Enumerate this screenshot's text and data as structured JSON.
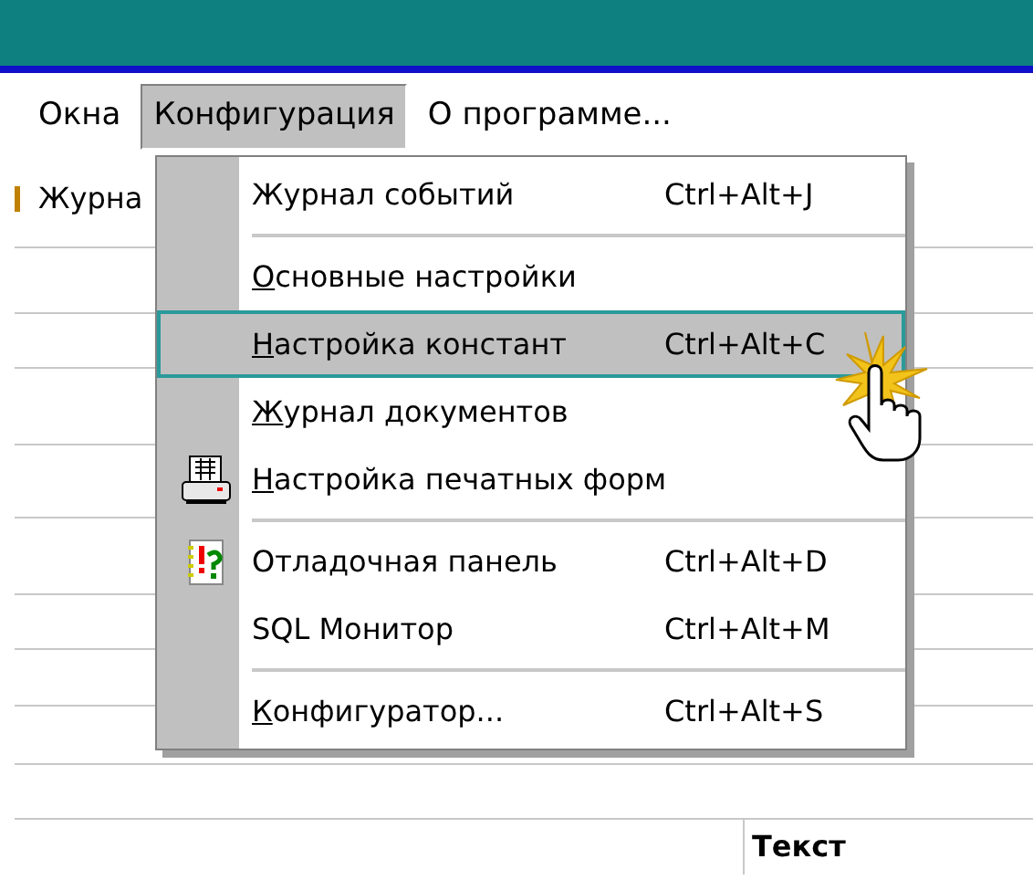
{
  "menubar": [
    {
      "label": "Окна",
      "open": false
    },
    {
      "label": "Конфигурация",
      "open": true
    },
    {
      "label": "О программе...",
      "open": false
    }
  ],
  "background": {
    "tab_label": "Журна",
    "cell": "Текст"
  },
  "menu": [
    {
      "kind": "item",
      "label": "Журнал событий",
      "shortcut": "Ctrl+Alt+J",
      "mnemonic": false,
      "selected": false
    },
    {
      "kind": "separator"
    },
    {
      "kind": "item",
      "label": "Основные настройки",
      "mnemonic": true,
      "selected": false
    },
    {
      "kind": "item",
      "label": "Настройка констант",
      "shortcut": "Ctrl+Alt+C",
      "mnemonic": true,
      "selected": true
    },
    {
      "kind": "item",
      "label": "Журнал документов",
      "mnemonic": true,
      "selected": false
    },
    {
      "kind": "printer",
      "label": "Настройка печатных форм",
      "mnemonic": true,
      "selected": false
    },
    {
      "kind": "separator"
    },
    {
      "kind": "debugger",
      "label": "Отладочная панель",
      "shortcut": "Ctrl+Alt+D",
      "mnemonic": false,
      "selected": false
    },
    {
      "kind": "item",
      "label": "SQL Монитор",
      "shortcut": "Ctrl+Alt+M",
      "mnemonic": false,
      "selected": false
    },
    {
      "kind": "separator"
    },
    {
      "kind": "item",
      "label": "Конфигуратор...",
      "shortcut": "Ctrl+Alt+S",
      "mnemonic": true,
      "selected": false
    }
  ]
}
